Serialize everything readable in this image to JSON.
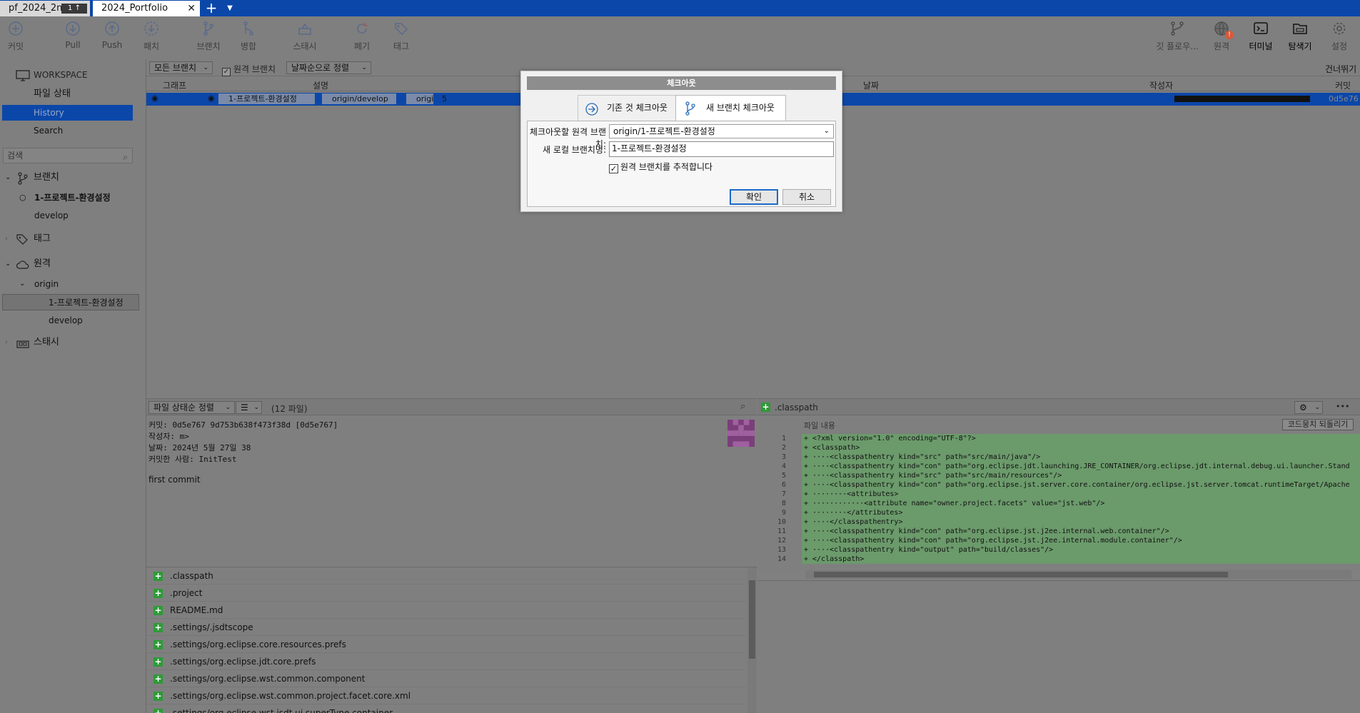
{
  "tabs": [
    {
      "label": "pf_2024_2nd",
      "badge": "1 ↑"
    },
    {
      "label": "2024_Portfolio",
      "close": "✕"
    }
  ],
  "tab_add": "+",
  "tab_menu": "▼",
  "toolbar": {
    "commit": "커밋",
    "pull": "Pull",
    "push": "Push",
    "patch": "패치",
    "branch": "브랜치",
    "merge": "병합",
    "stash": "스태시",
    "discard": "폐기",
    "tag": "태그",
    "gitflow": "깃 플로우...",
    "remote": "원격",
    "terminal": "터미널",
    "explorer": "탐색기",
    "settings": "설정",
    "remote_warning": "!"
  },
  "sidebar": {
    "workspace": "WORKSPACE",
    "file_status": "파일 상태",
    "history": "History",
    "search": "Search",
    "search_placeholder": "검색",
    "branches_header": "브랜치",
    "branches": [
      "1-프로젝트-환경설정",
      "develop"
    ],
    "tags_header": "태그",
    "remotes_header": "원격",
    "remote_name": "origin",
    "remote_branches": [
      "1-프로젝트-환경설정",
      "develop"
    ],
    "stash_header": "스태시"
  },
  "filterbar": {
    "all_branches": "모든 브랜치",
    "remote_branches": "원격 브랜치",
    "sort": "날짜순으로 정렬",
    "skip": "건너뛰기"
  },
  "log": {
    "headers": {
      "graph": "그래프",
      "description": "설명",
      "date": "날짜",
      "author": "작성자",
      "commit": "커밋"
    },
    "row": {
      "branch_tag": "1-프로젝트-환경설정",
      "remote_tag": "origin/develop",
      "extra_tag": "origi",
      "message": "5",
      "commit": "0d5e76"
    }
  },
  "bottom_left": {
    "sort": "파일 상태순 정렬",
    "file_count": "(12 파일)",
    "commit_line": "커밋: 0d5e767      9d753b638f473f38d [0d5e767]",
    "author_line": "작성자:                         m>",
    "date_line": "날짜: 2024년 5월 27일                38",
    "committer_line": "커밋한 사람: InitTest",
    "message": "first commit",
    "files": [
      ".classpath",
      ".project",
      "README.md",
      ".settings/.jsdtscope",
      ".settings/org.eclipse.core.resources.prefs",
      ".settings/org.eclipse.jdt.core.prefs",
      ".settings/org.eclipse.wst.common.component",
      ".settings/org.eclipse.wst.common.project.facet.core.xml",
      ".settings/org.eclipse.wst.jsdt.ui.superType.container"
    ]
  },
  "bottom_right": {
    "filename": ".classpath",
    "content_label": "파일 내용",
    "revert_button": "코드뭉치 되돌리기",
    "more": "•••",
    "diff_lines": [
      {
        "n": "1",
        "code": "+ <?xml version=\"1.0\" encoding=\"UTF-8\"?>"
      },
      {
        "n": "2",
        "code": "+ <classpath>"
      },
      {
        "n": "3",
        "code": "+ ····<classpathentry kind=\"src\" path=\"src/main/java\"/>"
      },
      {
        "n": "4",
        "code": "+ ····<classpathentry kind=\"con\" path=\"org.eclipse.jdt.launching.JRE_CONTAINER/org.eclipse.jdt.internal.debug.ui.launcher.Stand"
      },
      {
        "n": "5",
        "code": "+ ····<classpathentry kind=\"src\" path=\"src/main/resources\"/>"
      },
      {
        "n": "6",
        "code": "+ ····<classpathentry kind=\"con\" path=\"org.eclipse.jst.server.core.container/org.eclipse.jst.server.tomcat.runtimeTarget/Apache"
      },
      {
        "n": "7",
        "code": "+ ········<attributes>"
      },
      {
        "n": "8",
        "code": "+ ············<attribute name=\"owner.project.facets\" value=\"jst.web\"/>"
      },
      {
        "n": "9",
        "code": "+ ········</attributes>"
      },
      {
        "n": "10",
        "code": "+ ····</classpathentry>"
      },
      {
        "n": "11",
        "code": "+ ····<classpathentry kind=\"con\" path=\"org.eclipse.jst.j2ee.internal.web.container\"/>"
      },
      {
        "n": "12",
        "code": "+ ····<classpathentry kind=\"con\" path=\"org.eclipse.jst.j2ee.internal.module.container\"/>"
      },
      {
        "n": "13",
        "code": "+ ····<classpathentry kind=\"output\" path=\"build/classes\"/>"
      },
      {
        "n": "14",
        "code": "+ </classpath>"
      }
    ]
  },
  "dialog": {
    "title": "체크아웃",
    "tab_existing": "기존 것 체크아웃",
    "tab_new": "새 브랜치 체크아웃",
    "remote_label": "체크아웃할 원격 브랜치:",
    "remote_value": "origin/1-프로젝트-환경설정",
    "local_label": "새 로컬 브랜치명:",
    "local_value": "1-프로젝트-환경설정",
    "track_label": "원격 브랜치를 추적합니다",
    "track_checked": "✓",
    "ok": "확인",
    "cancel": "취소"
  },
  "colors": {
    "accent": "#0b47a9",
    "overlay": "#808080",
    "added": "#2e9a38",
    "diff_bg": "#6b9a6b"
  }
}
